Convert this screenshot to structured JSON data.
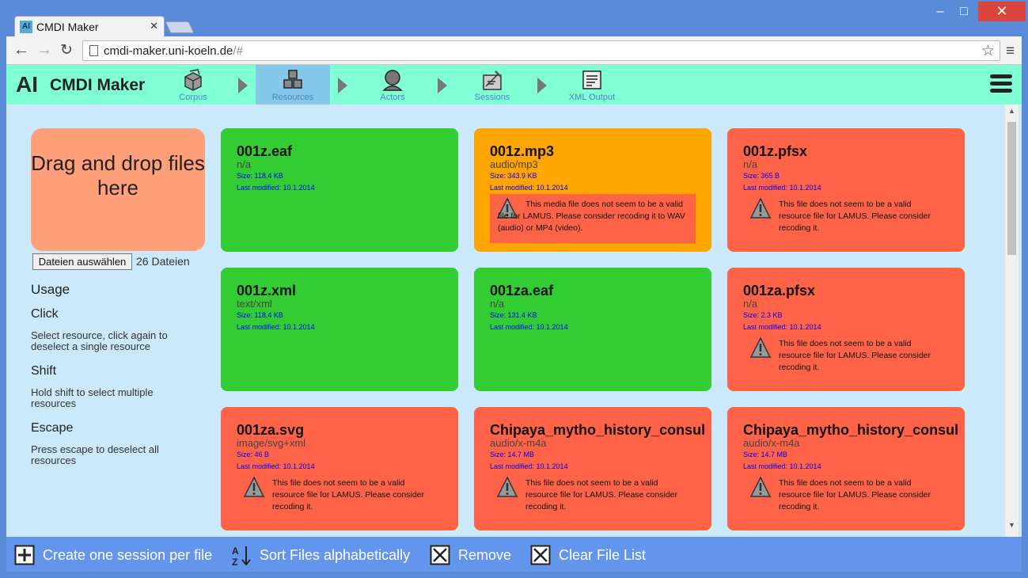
{
  "browser": {
    "tab_title": "CMDI Maker",
    "favicon_text": "AI",
    "url_host": "cmdi-maker.uni-koeln.de",
    "url_path": "/#",
    "window_controls": {
      "minimize": "–",
      "maximize": "□",
      "close": "✕"
    }
  },
  "app": {
    "logo": "AΙ",
    "title": "CMDI Maker",
    "steps": [
      {
        "label": "Corpus",
        "icon": "corpus-cubes-icon"
      },
      {
        "label": "Resources",
        "icon": "resources-cubes-icon"
      },
      {
        "label": "Actors",
        "icon": "actor-person-icon"
      },
      {
        "label": "Sessions",
        "icon": "session-clapper-icon"
      },
      {
        "label": "XML Output",
        "icon": "xml-document-icon"
      }
    ],
    "active_step": "Resources"
  },
  "sidebar": {
    "dropzone_text": "Drag and drop files here",
    "file_button": "Dateien auswählen",
    "file_count": "26 Dateien",
    "usage_title": "Usage",
    "items": [
      {
        "title": "Click",
        "text": "Select resource, click again to deselect a single resource"
      },
      {
        "title": "Shift",
        "text": "Hold shift to select multiple resources"
      },
      {
        "title": "Escape",
        "text": "Press escape to deselect all resources"
      }
    ]
  },
  "files": [
    {
      "name": "001z.eaf",
      "type": "n/a",
      "size": "Size: 118.4 KB",
      "modified": "Last modified: 10.1.2014",
      "status": "green",
      "color": "#33cc33",
      "warning": ""
    },
    {
      "name": "001z.mp3",
      "type": "audio/mp3",
      "size": "Size: 343.9 KB",
      "modified": "Last modified: 10.1.2014",
      "status": "orange",
      "color": "#ffa500",
      "warning": "This media file does not seem to be a valid file for LAMUS. Please consider recoding it to WAV (audio) or MP4 (video)."
    },
    {
      "name": "001z.pfsx",
      "type": "n/a",
      "size": "Size: 365 B",
      "modified": "Last modified: 10.1.2014",
      "status": "red",
      "color": "#ff6347",
      "warning": "This file does not seem to be a valid resource file for LAMUS. Please consider recoding it."
    },
    {
      "name": "001z.xml",
      "type": "text/xml",
      "size": "Size: 118.4 KB",
      "modified": "Last modified: 10.1.2014",
      "status": "green",
      "color": "#33cc33",
      "warning": ""
    },
    {
      "name": "001za.eaf",
      "type": "n/a",
      "size": "Size: 131.4 KB",
      "modified": "Last modified: 10.1.2014",
      "status": "green",
      "color": "#33cc33",
      "warning": ""
    },
    {
      "name": "001za.pfsx",
      "type": "n/a",
      "size": "Size: 2.3 KB",
      "modified": "Last modified: 10.1.2014",
      "status": "red",
      "color": "#ff6347",
      "warning": "This file does not seem to be a valid resource file for LAMUS. Please consider recoding it."
    },
    {
      "name": "001za.svg",
      "type": "image/svg+xml",
      "size": "Size: 46 B",
      "modified": "Last modified: 10.1.2014",
      "status": "red",
      "color": "#ff6347",
      "warning": "This file does not seem to be a valid resource file for LAMUS. Please consider recoding it."
    },
    {
      "name": "Chipaya_mytho_history_consul",
      "type": "audio/x-m4a",
      "size": "Size: 14.7 MB",
      "modified": "Last modified: 10.1.2014",
      "status": "red",
      "color": "#ff6347",
      "warning": "This file does not seem to be a valid resource file for LAMUS. Please consider recoding it."
    },
    {
      "name": "Chipaya_mytho_history_consul",
      "type": "audio/x-m4a",
      "size": "Size: 14.7 MB",
      "modified": "Last modified: 10.1.2014",
      "status": "red",
      "color": "#ff6347",
      "warning": "This file does not seem to be a valid resource file for LAMUS. Please consider recoding it."
    }
  ],
  "bottombar": {
    "create_sessions": "Create one session per file",
    "sort": "Sort Files alphabetically",
    "remove": "Remove",
    "clear": "Clear File List"
  }
}
